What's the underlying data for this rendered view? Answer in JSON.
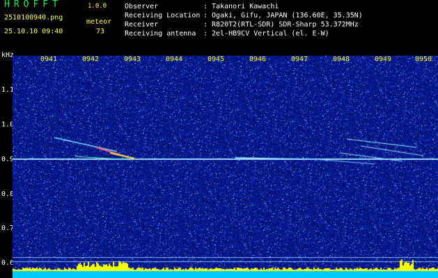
{
  "header": {
    "app_title": "HROFFT",
    "version": "1.0.0",
    "filename": "2510100940.png",
    "meteor_label": "meteor",
    "datetime": "25.10.10 09:40",
    "meteor_count": "73"
  },
  "info": [
    {
      "key": "Observer",
      "value": ": Takanori Kawachi"
    },
    {
      "key": "Receiving Location",
      "value": ": Ogaki, Gifu, JAPAN (136.60E, 35.35N)"
    },
    {
      "key": "Receiver",
      "value": ": R820T2(RTL-SDR) SDR-Sharp 53.372MHz"
    },
    {
      "key": "Receiving antenna",
      "value": ": 2el-HB9CV Vertical (el. E-W)"
    }
  ],
  "axis": {
    "unit": "kHz",
    "y_ticks": [
      "1.1",
      "1.0",
      "0.9",
      "0.8",
      "0.7",
      "0.6"
    ],
    "x_ticks": [
      "0941",
      "0942",
      "0943",
      "0944",
      "0945",
      "0946",
      "0947",
      "0948",
      "0949",
      "0950"
    ]
  },
  "colors": {
    "background": "#000000",
    "spectrogram_base": "#0a1a8a",
    "carrier": "#9fd8ff",
    "bottom_bar": "#00ccff",
    "level_bars": "#ffff00"
  }
}
